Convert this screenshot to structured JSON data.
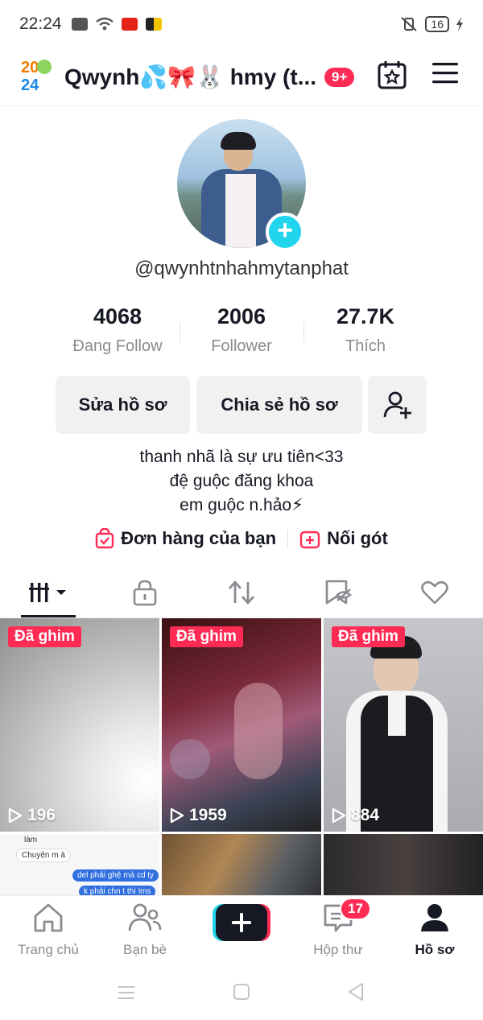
{
  "status_bar": {
    "time": "22:24",
    "battery": "16"
  },
  "header": {
    "username": "Qwynh💦🎀🐰 hmy (t...",
    "notification_badge": "9+",
    "logo_text": "2024"
  },
  "profile": {
    "handle": "@qwynhtnhahmytanphat",
    "stats": [
      {
        "value": "4068",
        "label": "Đang Follow"
      },
      {
        "value": "2006",
        "label": "Follower"
      },
      {
        "value": "27.7K",
        "label": "Thích"
      }
    ],
    "buttons": {
      "edit": "Sửa hồ sơ",
      "share": "Chia sẻ hồ sơ"
    },
    "bio": [
      "thanh nhã là sự ưu tiên<33",
      "đệ guộc đăng khoa",
      "em guộc n.hảo⚡"
    ],
    "shop_links": {
      "orders": "Đơn hàng của bạn",
      "add": "Nối gót"
    }
  },
  "videos": [
    {
      "pinned_label": "Đã ghim",
      "views": "196"
    },
    {
      "pinned_label": "Đã ghim",
      "views": "1959"
    },
    {
      "pinned_label": "Đã ghim",
      "views": "884"
    }
  ],
  "chat_preview": {
    "line1": "làm",
    "line2": "Chuyện m à",
    "line3": "del phải ghệ mà cd ty",
    "line4": "k phải chn t thì lms"
  },
  "bottom_nav": [
    {
      "label": "Trang chủ"
    },
    {
      "label": "Bạn bè"
    },
    {
      "label": ""
    },
    {
      "label": "Hộp thư",
      "badge": "17"
    },
    {
      "label": "Hồ sơ"
    }
  ],
  "colors": {
    "accent": "#fe2c55",
    "cyan": "#20d5ec",
    "text": "#161823",
    "muted": "#8a8b91"
  }
}
